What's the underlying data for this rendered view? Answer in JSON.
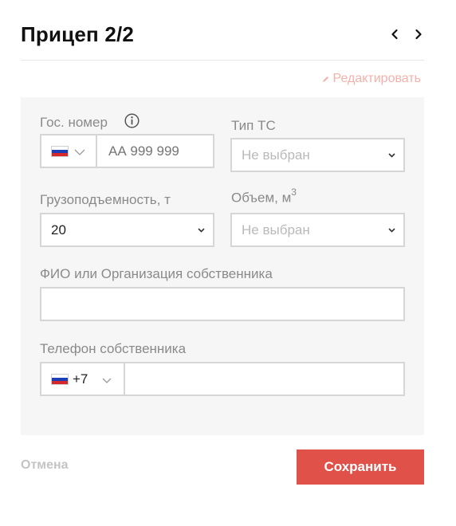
{
  "header": {
    "title": "Прицеп 2/2"
  },
  "edit": {
    "label": "Редактировать"
  },
  "form": {
    "plate": {
      "label": "Гос. номер",
      "placeholder": "АА 999 999"
    },
    "vehicle_type": {
      "label": "Тип ТС",
      "value": "Не выбран"
    },
    "capacity": {
      "label": "Грузоподъемность, т",
      "value": "20"
    },
    "volume": {
      "label": "Объем, м",
      "label_sup": "3",
      "value": "Не выбран"
    },
    "owner": {
      "label": "ФИО или Организация собственника",
      "value": ""
    },
    "phone": {
      "label": "Телефон собственника",
      "code": "+7",
      "value": ""
    }
  },
  "footer": {
    "cancel_label": "Отмена",
    "save_label": "Сохранить"
  },
  "colors": {
    "accent": "#e0514a",
    "edit_link": "#f3b1aa",
    "panel_bg": "#f6f6f6",
    "label": "#8a8a8a"
  }
}
